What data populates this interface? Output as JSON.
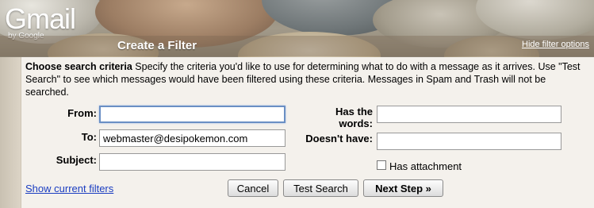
{
  "logo": {
    "text": "Gmail",
    "by": "by Google"
  },
  "header": {
    "title": "Create a Filter",
    "hide_link": "Hide filter options"
  },
  "criteria": {
    "heading": "Choose search criteria",
    "description": "Specify the criteria you'd like to use for determining what to do with a message as it arrives. Use \"Test Search\" to see which messages would have been filtered using these criteria. Messages in Spam and Trash will not be searched."
  },
  "fields": {
    "from_label": "From:",
    "from_value": "",
    "to_label": "To:",
    "to_value": "webmaster@desipokemon.com",
    "subject_label": "Subject:",
    "subject_value": "",
    "has_words_label_1": "Has the",
    "has_words_label_2": "words:",
    "has_words_value": "",
    "doesnt_have_label": "Doesn't have:",
    "doesnt_have_value": ""
  },
  "attachment": {
    "label": "Has attachment",
    "checked": false
  },
  "footer": {
    "show_filters": "Show current filters",
    "cancel": "Cancel",
    "test_search": "Test Search",
    "next_step": "Next Step »"
  },
  "colors": {
    "link": "#1a3dc1",
    "panel": "#f4f1ec"
  }
}
